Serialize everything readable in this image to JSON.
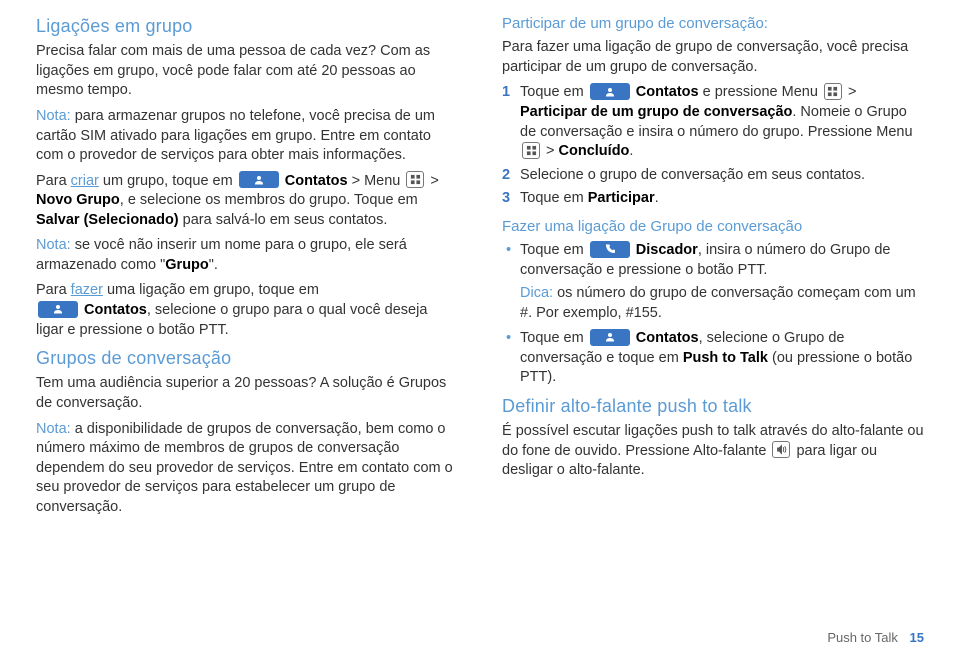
{
  "col1": {
    "h_ligacoes": "Ligações em grupo",
    "p_precisa": "Precisa falar com mais de uma pessoa de cada vez? Com as ligações em grupo, você pode falar com até 20 pessoas ao mesmo tempo.",
    "lbl_nota1": "Nota:",
    "p_nota1": " para armazenar grupos no telefone, você precisa de um cartão SIM ativado para ligações em grupo. Entre em contato com o provedor de serviços para obter mais informações.",
    "p_criar_1": "Para ",
    "u_criar": "criar",
    "p_criar_2": " um grupo, toque em ",
    "lbl_contatos1": "Contatos",
    "p_criar_3": " > Menu ",
    "p_criar_4": " > ",
    "lbl_novo_grupo": "Novo Grupo",
    "p_criar_5": ", e selecione os membros do grupo. Toque em ",
    "lbl_salvar": "Salvar (Selecionado)",
    "p_criar_6": " para salvá-lo em seus contatos.",
    "lbl_nota2": "Nota:",
    "p_nota2": " se você não inserir um nome para o grupo, ele será armazenado como \"",
    "lbl_grupo": "Grupo",
    "p_nota2b": "\".",
    "p_fazer_1": "Para ",
    "u_fazer": "fazer",
    "p_fazer_2": " uma ligação em grupo, toque em ",
    "lbl_contatos2": "Contatos",
    "p_fazer_3": ", selecione o grupo para o qual você deseja ligar e pressione o botão PTT.",
    "h_grupos": "Grupos de conversação",
    "p_audiencia": "Tem uma audiência superior a 20 pessoas? A solução é Grupos de conversação.",
    "lbl_nota3": "Nota:",
    "p_nota3": " a disponibilidade de grupos de conversação, bem como o número máximo de membros de grupos de conversação dependem do seu provedor de serviços. Entre em contato com o seu provedor de serviços para estabelecer um grupo de conversação."
  },
  "col2": {
    "h_participar": "Participar de um grupo de conversação:",
    "p_para_fazer": "Para fazer uma ligação de grupo de conversação, você precisa participar de um grupo de conversação.",
    "num1": "1",
    "s1_1": "Toque em ",
    "s1_contatos": "Contatos",
    "s1_2": " e pressione Menu ",
    "s1_3": " > ",
    "s1_participar": "Participar de um grupo de conversação",
    "s1_4": ". Nomeie o Grupo de conversação e insira o número do grupo. Pressione Menu ",
    "s1_5": " > ",
    "s1_concluido": "Concluído",
    "s1_6": ".",
    "num2": "2",
    "s2": "Selecione o grupo de conversação em seus contatos.",
    "num3": "3",
    "s3_1": "Toque em ",
    "s3_participar": "Participar",
    "s3_2": ".",
    "h_fazer_lig": "Fazer uma ligação de Grupo de conversação",
    "b1_1": "Toque em ",
    "b1_discador": "Discador",
    "b1_2": ", insira o número do Grupo de conversação e pressione o botão PTT.",
    "lbl_dica": "Dica:",
    "b1_dica": " os número do grupo de conversação começam com um #. Por exemplo, #155.",
    "b2_1": "Toque em ",
    "b2_contatos": "Contatos",
    "b2_2": ", selecione o Grupo de conversação e toque em ",
    "b2_ptt": "Push to Talk",
    "b2_3": " (ou pressione o botão PTT).",
    "h_definir": "Definir alto-falante push to talk",
    "p_def_1": "É possível escutar ligações push to talk através do alto-falante ou do fone de ouvido. Pressione Alto-falante ",
    "p_def_2": " para ligar ou desligar o alto-falante."
  },
  "footer": {
    "label": "Push to Talk",
    "page": "15"
  }
}
